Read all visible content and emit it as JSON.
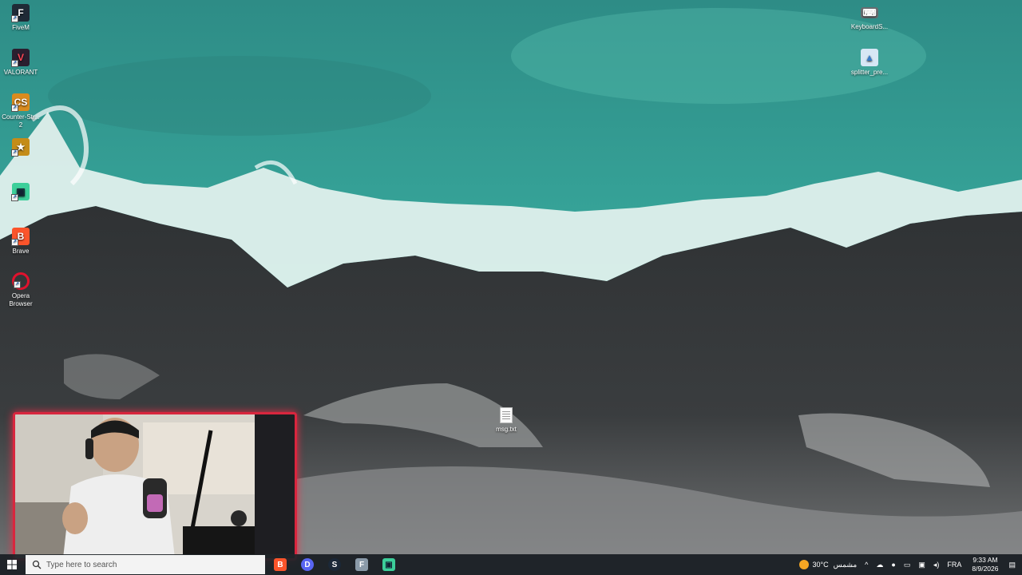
{
  "desktop_icons_left": [
    {
      "label": "FiveM",
      "icon": "fivem-icon",
      "color": "#1f2a36"
    },
    {
      "label": "VALORANT",
      "icon": "valorant-icon",
      "color": "#2a1f2f"
    },
    {
      "label": "Counter-Str... 2",
      "icon": "counter-strike-icon",
      "color": "#d98b1e"
    },
    {
      "label": "",
      "icon": "game-icon",
      "color": "#c48c18"
    },
    {
      "label": "",
      "icon": "chat-app-icon",
      "color": "#3ccf9a"
    },
    {
      "label": "Brave",
      "icon": "brave-icon",
      "color": "#fb542b"
    },
    {
      "label": "Opera Browser",
      "icon": "opera-icon",
      "color": "#e0122d"
    }
  ],
  "desktop_icons_right": [
    {
      "label": "KeyboardS...",
      "icon": "keyboard-settings-icon"
    },
    {
      "label": "splitter_pre...",
      "icon": "image-file-icon"
    }
  ],
  "desktop_file": {
    "label": "msg.txt",
    "icon": "text-file-icon"
  },
  "taskbar": {
    "search_placeholder": "Type here to search",
    "apps": [
      {
        "name": "brave-taskbar-icon",
        "color": "#fb542b",
        "glyph": "B"
      },
      {
        "name": "discord-taskbar-icon",
        "color": "#5865f2",
        "glyph": "D"
      },
      {
        "name": "steam-taskbar-icon",
        "color": "#1b2838",
        "glyph": "S"
      },
      {
        "name": "file-taskbar-icon",
        "color": "#8a9aa8",
        "glyph": "F"
      },
      {
        "name": "chat-taskbar-icon",
        "color": "#3ccf9a",
        "glyph": "C"
      }
    ],
    "weather_temp": "30°C",
    "weather_desc": "مشمس",
    "language": "FRA",
    "time": "9:33 AM",
    "date": "8/9/2026"
  }
}
